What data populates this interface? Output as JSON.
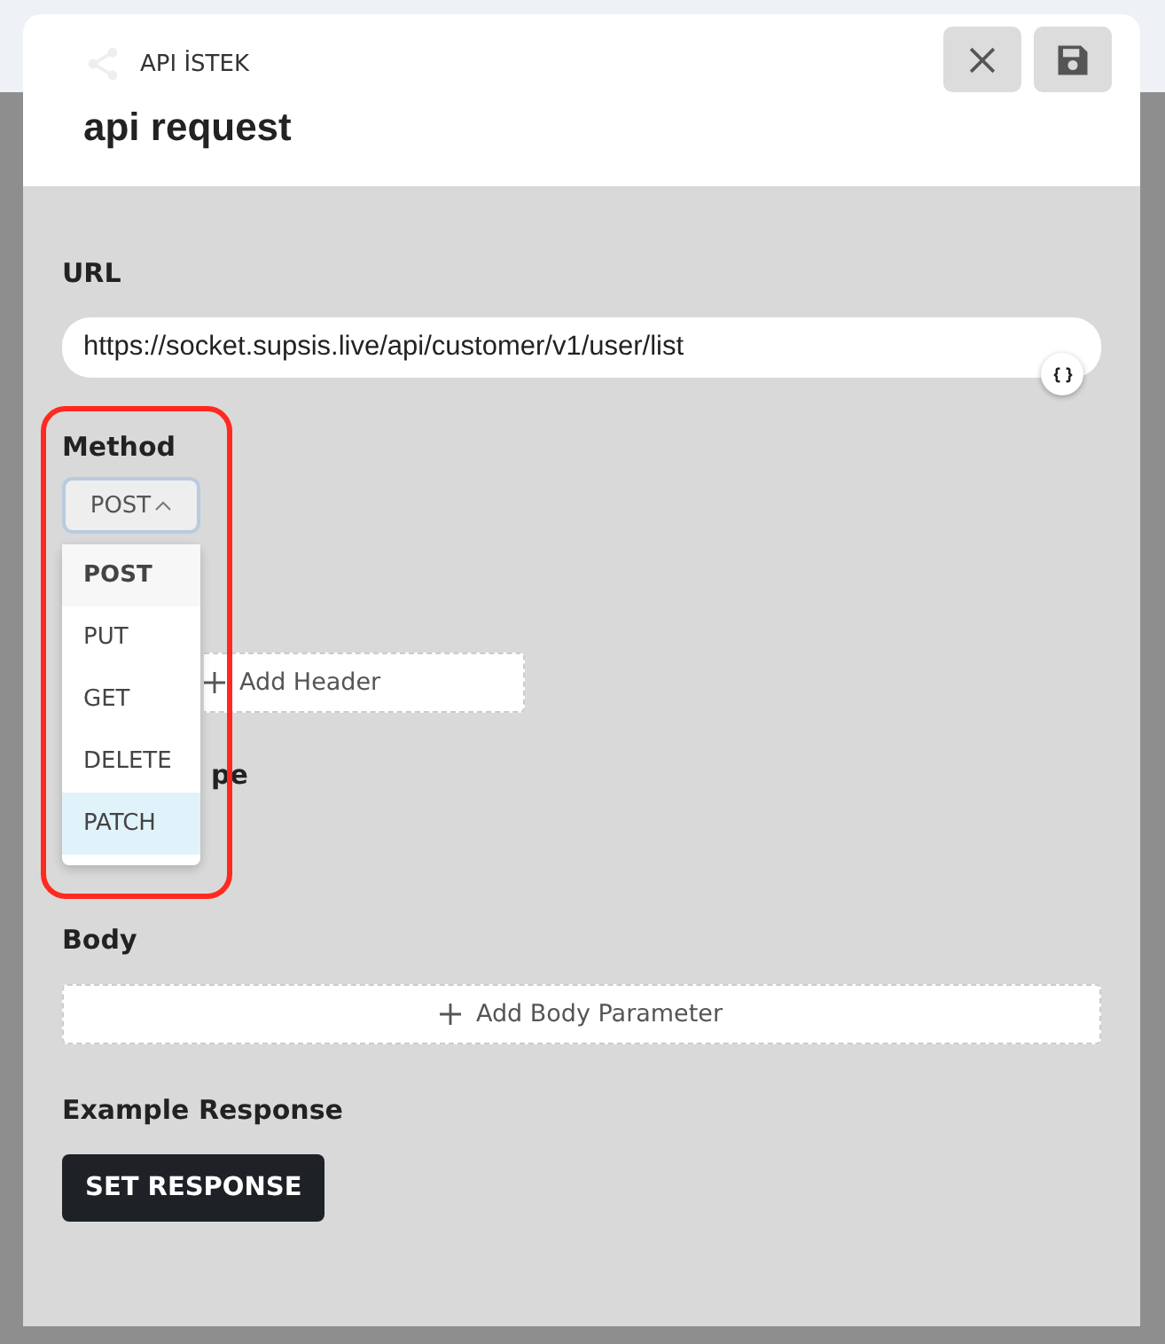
{
  "header": {
    "kind_label": "API İSTEK",
    "title": "api request"
  },
  "url": {
    "label": "URL",
    "value": "https://socket.supsis.live/api/customer/v1/user/list"
  },
  "method": {
    "label": "Method",
    "value": "POST",
    "expanded": true,
    "options": [
      {
        "label": "POST",
        "selected": true,
        "hovered": false
      },
      {
        "label": "PUT",
        "selected": false,
        "hovered": false
      },
      {
        "label": "GET",
        "selected": false,
        "hovered": false
      },
      {
        "label": "DELETE",
        "selected": false,
        "hovered": false
      },
      {
        "label": "PATCH",
        "selected": false,
        "hovered": true
      }
    ]
  },
  "headers": {
    "add_button": "Add Header"
  },
  "partial_label": "pe",
  "body": {
    "label": "Body",
    "add_button": "Add Body Parameter"
  },
  "example_response": {
    "label": "Example Response",
    "button": "SET RESPONSE"
  }
}
